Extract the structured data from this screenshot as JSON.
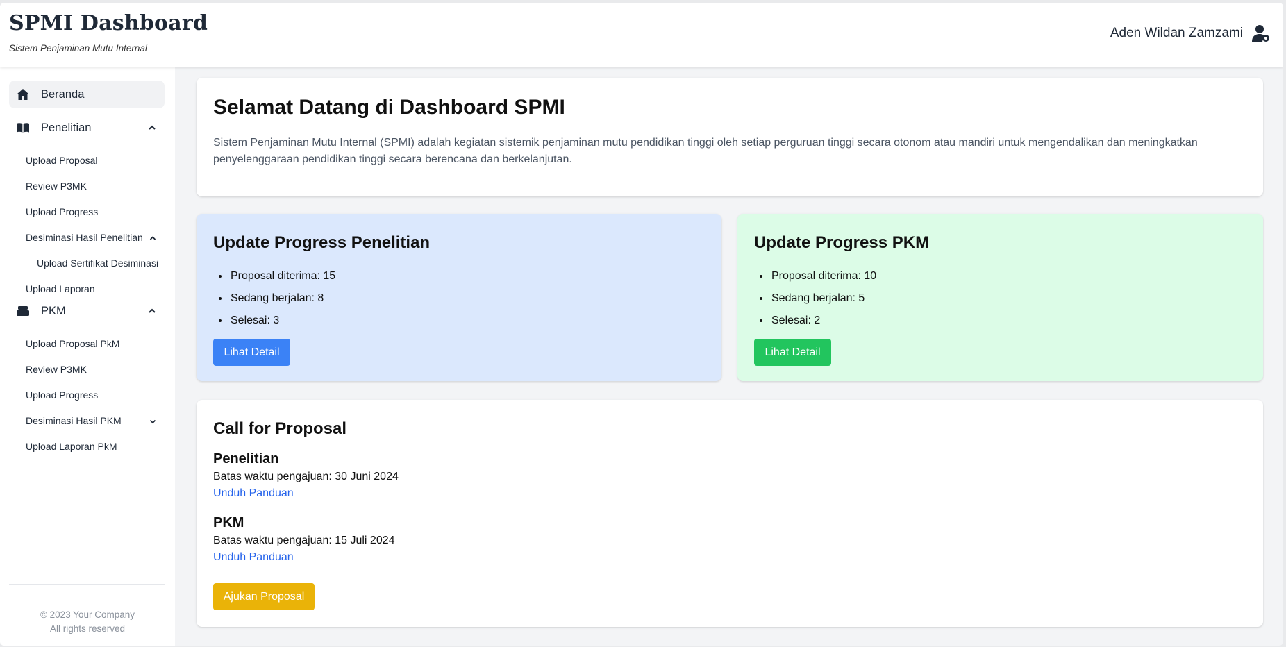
{
  "header": {
    "title": "SPMI Dashboard",
    "subtitle": "Sistem Penjaminan Mutu Internal",
    "user_name": "Aden Wildan Zamzami"
  },
  "sidebar": {
    "home": "Beranda",
    "penelitian": {
      "label": "Penelitian",
      "items": [
        "Upload Proposal",
        "Review P3MK",
        "Upload Progress",
        "Desiminasi Hasil Penelitian",
        "Upload Sertifikat Desiminasi",
        "Upload Laporan"
      ]
    },
    "pkm": {
      "label": "PKM",
      "items": [
        "Upload Proposal PkM",
        "Review P3MK",
        "Upload Progress",
        "Desiminasi Hasil PKM",
        "Upload Laporan PkM"
      ]
    },
    "footer_line1": "© 2023 Your Company",
    "footer_line2": "All rights reserved"
  },
  "welcome": {
    "title": "Selamat Datang di Dashboard SPMI",
    "description": "Sistem Penjaminan Mutu Internal (SPMI) adalah kegiatan sistemik penjaminan mutu pendidikan tinggi oleh setiap perguruan tinggi secara otonom atau mandiri untuk mengendalikan dan meningkatkan penyelenggaraan pendidikan tinggi secara berencana dan berkelanjutan."
  },
  "progress_penelitian": {
    "title": "Update Progress Penelitian",
    "items": [
      "Proposal diterima: 15",
      "Sedang berjalan: 8",
      "Selesai: 3"
    ],
    "button": "Lihat Detail"
  },
  "progress_pkm": {
    "title": "Update Progress PKM",
    "items": [
      "Proposal diterima: 10",
      "Sedang berjalan: 5",
      "Selesai: 2"
    ],
    "button": "Lihat Detail"
  },
  "call_for_proposal": {
    "title": "Call for Proposal",
    "penelitian": {
      "heading": "Penelitian",
      "deadline": "Batas waktu pengajuan: 30 Juni 2024",
      "link": "Unduh Panduan"
    },
    "pkm": {
      "heading": "PKM",
      "deadline": "Batas waktu pengajuan: 15 Juli 2024",
      "link": "Unduh Panduan"
    },
    "button": "Ajukan Proposal"
  },
  "colors": {
    "blue": "#3b82f6",
    "green": "#22c55e",
    "yellow": "#eab308",
    "link": "#2563eb"
  }
}
